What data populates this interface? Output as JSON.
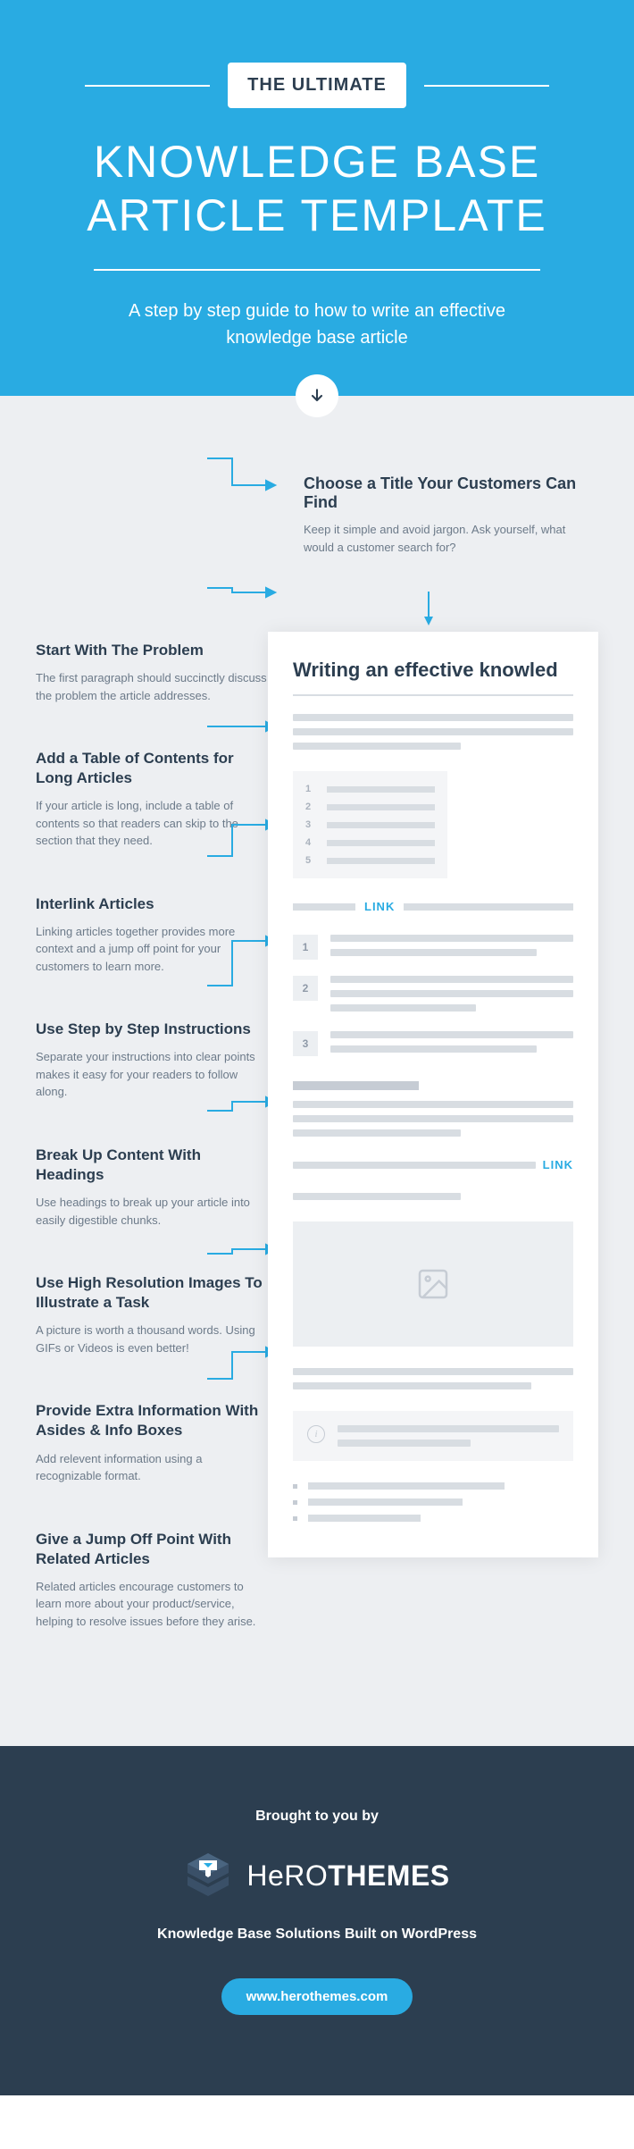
{
  "hero": {
    "badge": "THE ULTIMATE",
    "title_line1": "KNOWLEDGE BASE",
    "title_line2": "ARTICLE TEMPLATE",
    "subtitle": "A step by step guide to how to write an effective knowledge base article"
  },
  "top_tip": {
    "heading": "Choose a Title Your Customers Can Find",
    "desc": "Keep it simple and avoid jargon. Ask yourself, what would a customer search for?"
  },
  "tips": [
    {
      "heading": "Start With The Problem",
      "desc": "The first paragraph should succinctly discuss the problem the article addresses."
    },
    {
      "heading": "Add a Table of Contents for Long Articles",
      "desc": "If your article is long, include a table of contents so that readers can skip to the section that they need."
    },
    {
      "heading": "Interlink Articles",
      "desc": "Linking articles together provides more context and a jump off point for your customers to learn more."
    },
    {
      "heading": "Use Step by Step Instructions",
      "desc": "Separate your instructions into clear points makes it easy for your readers to follow along."
    },
    {
      "heading": "Break Up Content With Headings",
      "desc": "Use headings to break up your article into easily digestible chunks."
    },
    {
      "heading": "Use High Resolution Images To Illustrate a Task",
      "desc": "A picture is worth a thousand words. Using GIFs or Videos is even better!"
    },
    {
      "heading": "Provide Extra Information With Asides & Info Boxes",
      "desc": "Add relevent information using a recognizable format."
    },
    {
      "heading": "Give a Jump Off Point With Related Articles",
      "desc": "Related articles encourage customers to learn more about your product/service, helping to resolve issues before they arise."
    }
  ],
  "mockup": {
    "title": "Writing an effective knowled",
    "toc_numbers": [
      "1",
      "2",
      "3",
      "4",
      "5"
    ],
    "link_label": "LINK",
    "step_numbers": [
      "1",
      "2",
      "3"
    ]
  },
  "footer": {
    "brought": "Brought to you by",
    "brand_light": "HeRO",
    "brand_bold": "THEMES",
    "tagline": "Knowledge Base Solutions Built on WordPress",
    "url": "www.herothemes.com"
  }
}
